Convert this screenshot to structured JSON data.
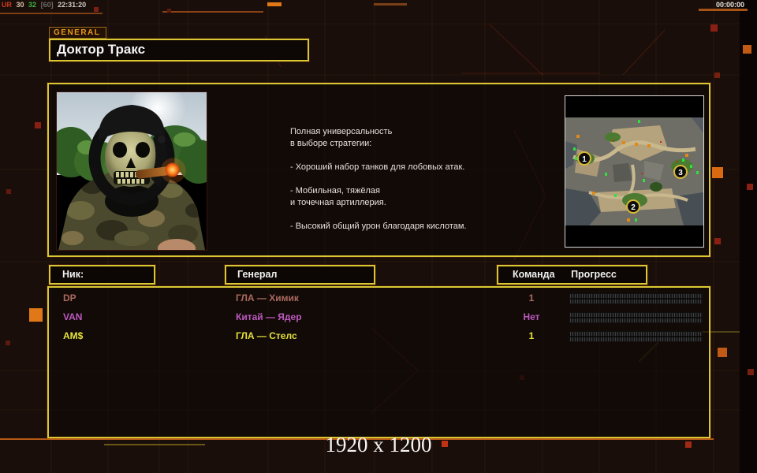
{
  "overlay": {
    "left": {
      "tag": "UR",
      "fps": "30",
      "value": "32",
      "cap": "[60]",
      "clock": "22:31:20"
    },
    "right_timer": "00:00:00"
  },
  "header": {
    "tab_label": "GENERAL",
    "title": "Доктор Тракс"
  },
  "profile": {
    "portrait_alt": "doctor-thrax-portrait",
    "paragraphs": [
      [
        "Полная универсальность",
        "в выборе стратегии:"
      ],
      [
        "- Хороший набор танков для лобовых атак."
      ],
      [
        "- Мобильная, тяжёлая",
        "и точечная артиллерия."
      ],
      [
        "- Высокий общий урон благодаря кислотам."
      ]
    ],
    "minimap": {
      "markers": [
        {
          "label": "1"
        },
        {
          "label": "2"
        },
        {
          "label": "3"
        }
      ]
    }
  },
  "table": {
    "headers": {
      "nick": "Ник:",
      "general": "Генерал",
      "team": "Команда",
      "progress": "Прогресс"
    },
    "rows": [
      {
        "nick": "DP",
        "general": "ГЛА — Химик",
        "team": "1",
        "color": "#ab6a60"
      },
      {
        "nick": "VAN",
        "general": "Китай — Ядер",
        "team": "Нет",
        "color": "#bd59c0"
      },
      {
        "nick": "AM$",
        "general": "ГЛА — Стелс",
        "team": "1",
        "color": "#e4e23a"
      }
    ]
  },
  "footer": {
    "resolution": "1920 x 1200"
  },
  "colors": {
    "background": "#190e09",
    "panel_border_yellow": "#d9c832",
    "accent_orange": "#e07818",
    "tab_text": "#e8991c",
    "overlay_tag": "#cf3a22",
    "overlay_value_green": "#3db83d",
    "marker_ring": "#d8b838"
  }
}
